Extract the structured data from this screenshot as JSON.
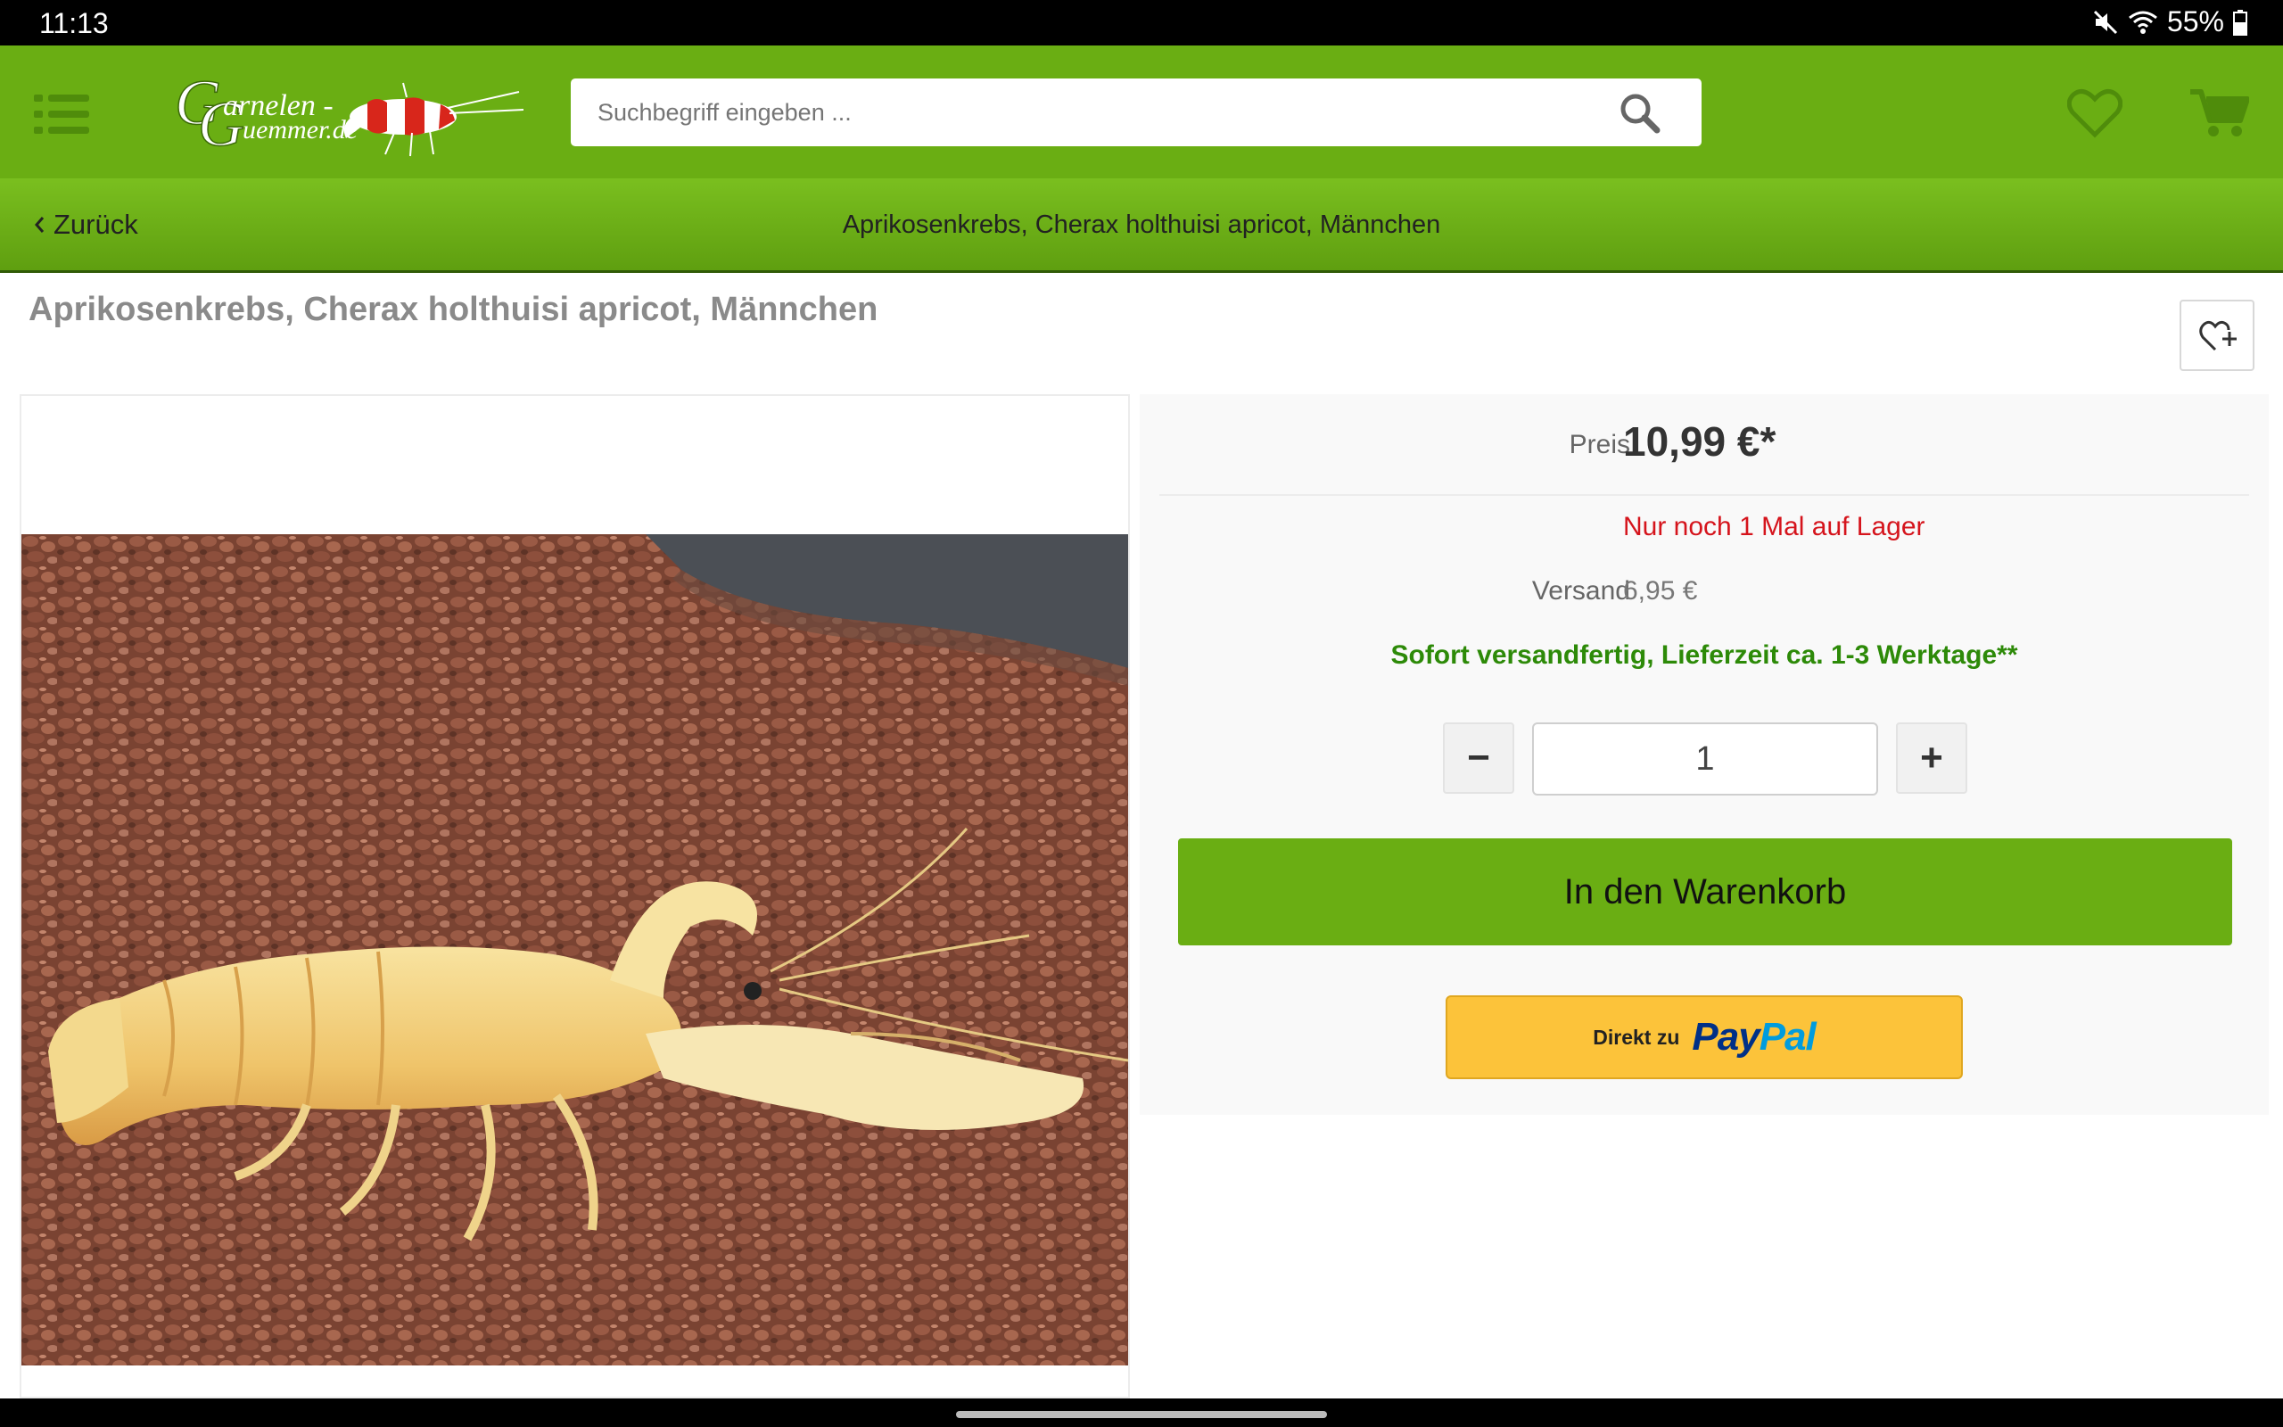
{
  "status_bar": {
    "time": "11:13",
    "battery": "55%",
    "icons": [
      "mute-icon",
      "wifi-icon",
      "battery-icon"
    ]
  },
  "header": {
    "logo_text_line1": "Garnelen -",
    "logo_text_line2": "Guemmer.de",
    "search_placeholder": "Suchbegriff eingeben ...",
    "icons": [
      "menu-icon",
      "search-icon",
      "heart-icon",
      "cart-icon"
    ],
    "brand_color": "#6aae13"
  },
  "breadcrumb": {
    "back_label": "Zurück",
    "title": "Aprikosenkrebs, Cherax holthuisi apricot, Männchen"
  },
  "product": {
    "title": "Aprikosenkrebs, Cherax holthuisi apricot, Männchen",
    "image_alt": "apricot crayfish on reddish gravel",
    "price_label": "Preis",
    "price": "10,99 €*",
    "stock_text": "Nur noch 1 Mal auf Lager",
    "shipping_label": "Versand",
    "shipping_value": "6,95 €",
    "delivery_text": "Sofort versandfertig, Lieferzeit ca. 1-3 Werktage**",
    "quantity": "1",
    "minus_label": "−",
    "plus_label": "+",
    "add_to_cart_label": "In den Warenkorb",
    "paypal_prefix": "Direkt zu",
    "paypal_word_1": "Pay",
    "paypal_word_2": "Pal",
    "colors": {
      "stock": "#d5141c",
      "delivery": "#2d8a08",
      "paypal": "#fcc33a"
    }
  }
}
